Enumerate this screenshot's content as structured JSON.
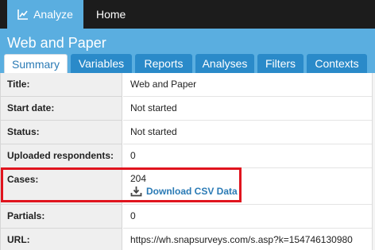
{
  "nav": {
    "analyze_label": "Analyze",
    "home_label": "Home"
  },
  "survey": {
    "title": "Web and Paper"
  },
  "tabs": [
    {
      "label": "Summary",
      "active": true
    },
    {
      "label": "Variables"
    },
    {
      "label": "Reports"
    },
    {
      "label": "Analyses"
    },
    {
      "label": "Filters"
    },
    {
      "label": "Contexts"
    }
  ],
  "summary": {
    "title": {
      "label": "Title:",
      "value": "Web and Paper"
    },
    "start_date": {
      "label": "Start date:",
      "value": "Not started"
    },
    "status": {
      "label": "Status:",
      "value": "Not started"
    },
    "uploaded": {
      "label": "Uploaded respondents:",
      "value": "0"
    },
    "cases": {
      "label": "Cases:",
      "value": "204",
      "download_label": "Download CSV Data"
    },
    "partials": {
      "label": "Partials:",
      "value": "0"
    },
    "url": {
      "label": "URL:",
      "value": "https://wh.snapsurveys.com/s.asp?k=154746130980"
    }
  },
  "colors": {
    "accent": "#5aaee0",
    "tab_blue": "#2a8ac9",
    "link": "#2a7ab5",
    "highlight": "#e0141e",
    "topbar": "#1c1c1c"
  },
  "icons": {
    "analyze": "line-chart-icon",
    "download": "download-tray-icon"
  }
}
